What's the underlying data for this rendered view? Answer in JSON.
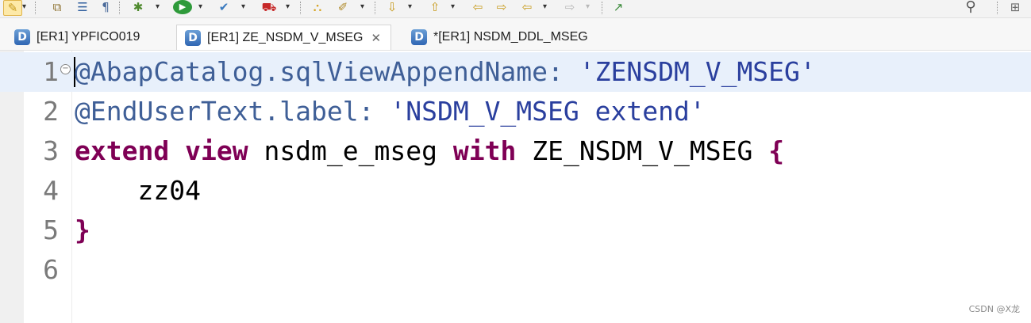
{
  "toolbar": {
    "buttons": [
      {
        "name": "edit-pencil-icon",
        "glyph": "✎"
      },
      {
        "name": "dropdown-icon",
        "glyph": "▾"
      },
      {
        "name": "copy-objects-icon",
        "glyph": "⧉"
      },
      {
        "name": "document-list-icon",
        "glyph": "☰"
      },
      {
        "name": "pilcrow-icon",
        "glyph": "¶"
      },
      {
        "name": "debug-bug-icon",
        "glyph": "✱"
      },
      {
        "name": "run-icon",
        "glyph": "▶"
      },
      {
        "name": "activate-icon",
        "glyph": "✔"
      },
      {
        "name": "transport-icon",
        "glyph": "⛟"
      },
      {
        "name": "open-folder-icon",
        "glyph": "⛬"
      },
      {
        "name": "magic-wand-icon",
        "glyph": "✐"
      },
      {
        "name": "next-annotation-icon",
        "glyph": "⇩"
      },
      {
        "name": "previous-annotation-icon",
        "glyph": "⇧"
      },
      {
        "name": "last-edit-location-icon",
        "glyph": "⇦"
      },
      {
        "name": "back-icon",
        "glyph": "⇦"
      },
      {
        "name": "forward-icon",
        "glyph": "⇨"
      },
      {
        "name": "open-perspective-icon",
        "glyph": "↗"
      },
      {
        "name": "search-icon",
        "glyph": "⚲"
      },
      {
        "name": "perspective-icon",
        "glyph": "⊞"
      }
    ]
  },
  "tabs": [
    {
      "label": "[ER1] YPFICO019",
      "icon": "D",
      "active": false
    },
    {
      "label": "[ER1] ZE_NSDM_V_MSEG",
      "icon": "D",
      "active": true,
      "close": "✕"
    },
    {
      "label": "*[ER1] NSDM_DDL_MSEG",
      "icon": "D",
      "active": false
    }
  ],
  "editor": {
    "lines": [
      {
        "number": "1",
        "tokens": [
          {
            "text": "@AbapCatalog.sqlViewAppendName: ",
            "kind": "ann"
          },
          {
            "text": "'ZENSDM_V_MSEG'",
            "kind": "str"
          }
        ]
      },
      {
        "number": "2",
        "tokens": [
          {
            "text": "@EndUserText.label: ",
            "kind": "ann"
          },
          {
            "text": "'NSDM_V_MSEG extend'",
            "kind": "str"
          }
        ]
      },
      {
        "number": "3",
        "tokens": [
          {
            "text": "extend",
            "kind": "kw"
          },
          {
            "text": " ",
            "kind": "plain"
          },
          {
            "text": "view",
            "kind": "kw"
          },
          {
            "text": " nsdm_e_mseg ",
            "kind": "plain"
          },
          {
            "text": "with",
            "kind": "kw"
          },
          {
            "text": " ZE_NSDM_V_MSEG ",
            "kind": "plain"
          },
          {
            "text": "{",
            "kind": "brace"
          }
        ]
      },
      {
        "number": "4",
        "tokens": [
          {
            "text": "    zz04",
            "kind": "plain"
          }
        ]
      },
      {
        "number": "5",
        "tokens": [
          {
            "text": "}",
            "kind": "brace"
          }
        ]
      },
      {
        "number": "6",
        "tokens": []
      }
    ],
    "fold_marker": "−"
  },
  "watermark": "CSDN @X龙",
  "colors": {
    "annotation": "#3f5f97",
    "keyword": "#7f0055",
    "string": "#2a3f9e",
    "current_line": "#e8f0fb"
  }
}
